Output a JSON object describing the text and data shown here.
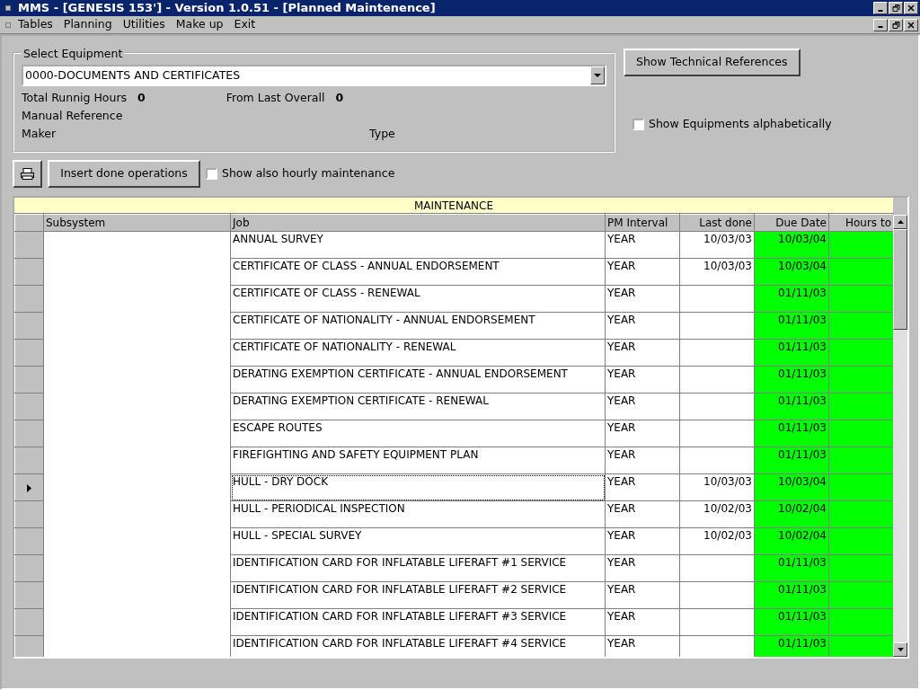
{
  "window": {
    "title": "MMS - [GENESIS 153'] - Version 1.0.51 - [Planned Maintenence]"
  },
  "menu": [
    "Tables",
    "Planning",
    "Utilities",
    "Make up",
    "Exit"
  ],
  "equipment": {
    "legend": "Select Equipment",
    "value": "0000-DOCUMENTS AND CERTIFICATES",
    "total_hours_label": "Total Runnig Hours",
    "total_hours": "0",
    "from_last_label": "From Last Overall",
    "from_last": "0",
    "manual_label": "Manual Reference",
    "maker_label": "Maker",
    "type_label": "Type"
  },
  "tech_button": "Show Technical References",
  "alpha_check": {
    "label": "Show Equipments alphabetically",
    "checked": false
  },
  "insert_button": "Insert done operations",
  "hourly_check": {
    "label": "Show also hourly maintenance",
    "checked": false
  },
  "table": {
    "title": "MAINTENANCE",
    "columns": [
      "Subsystem",
      "Job",
      "PM Interval",
      "Last done",
      "Due Date",
      "Hours to"
    ],
    "rows": [
      {
        "job": "ANNUAL SURVEY",
        "interval": "YEAR",
        "last": "10/03/03",
        "due": "10/03/04",
        "selected": false
      },
      {
        "job": "CERTIFICATE OF CLASS - ANNUAL ENDORSEMENT",
        "interval": "YEAR",
        "last": "10/03/03",
        "due": "10/03/04",
        "selected": false
      },
      {
        "job": "CERTIFICATE OF CLASS - RENEWAL",
        "interval": "YEAR",
        "last": "",
        "due": "01/11/03",
        "selected": false
      },
      {
        "job": "CERTIFICATE OF NATIONALITY - ANNUAL ENDORSEMENT",
        "interval": "YEAR",
        "last": "",
        "due": "01/11/03",
        "selected": false
      },
      {
        "job": "CERTIFICATE OF NATIONALITY - RENEWAL",
        "interval": "YEAR",
        "last": "",
        "due": "01/11/03",
        "selected": false
      },
      {
        "job": "DERATING EXEMPTION CERTIFICATE - ANNUAL ENDORSEMENT",
        "interval": "YEAR",
        "last": "",
        "due": "01/11/03",
        "selected": false
      },
      {
        "job": "DERATING EXEMPTION CERTIFICATE - RENEWAL",
        "interval": "YEAR",
        "last": "",
        "due": "01/11/03",
        "selected": false
      },
      {
        "job": "ESCAPE ROUTES",
        "interval": "YEAR",
        "last": "",
        "due": "01/11/03",
        "selected": false
      },
      {
        "job": "FIREFIGHTING AND SAFETY EQUIPMENT PLAN",
        "interval": "YEAR",
        "last": "",
        "due": "01/11/03",
        "selected": false
      },
      {
        "job": "HULL - DRY DOCK",
        "interval": "YEAR",
        "last": "10/03/03",
        "due": "10/03/04",
        "selected": true
      },
      {
        "job": "HULL - PERIODICAL INSPECTION",
        "interval": "YEAR",
        "last": "10/02/03",
        "due": "10/02/04",
        "selected": false
      },
      {
        "job": "HULL - SPECIAL SURVEY",
        "interval": "YEAR",
        "last": "10/02/03",
        "due": "10/02/04",
        "selected": false
      },
      {
        "job": "IDENTIFICATION CARD FOR INFLATABLE LIFERAFT #1 SERVICE",
        "interval": "YEAR",
        "last": "",
        "due": "01/11/03",
        "selected": false
      },
      {
        "job": "IDENTIFICATION CARD FOR INFLATABLE LIFERAFT #2 SERVICE",
        "interval": "YEAR",
        "last": "",
        "due": "01/11/03",
        "selected": false
      },
      {
        "job": "IDENTIFICATION CARD FOR INFLATABLE LIFERAFT #3 SERVICE",
        "interval": "YEAR",
        "last": "",
        "due": "01/11/03",
        "selected": false
      },
      {
        "job": "IDENTIFICATION CARD FOR INFLATABLE LIFERAFT #4 SERVICE",
        "interval": "YEAR",
        "last": "",
        "due": "01/11/03",
        "selected": false
      }
    ]
  }
}
